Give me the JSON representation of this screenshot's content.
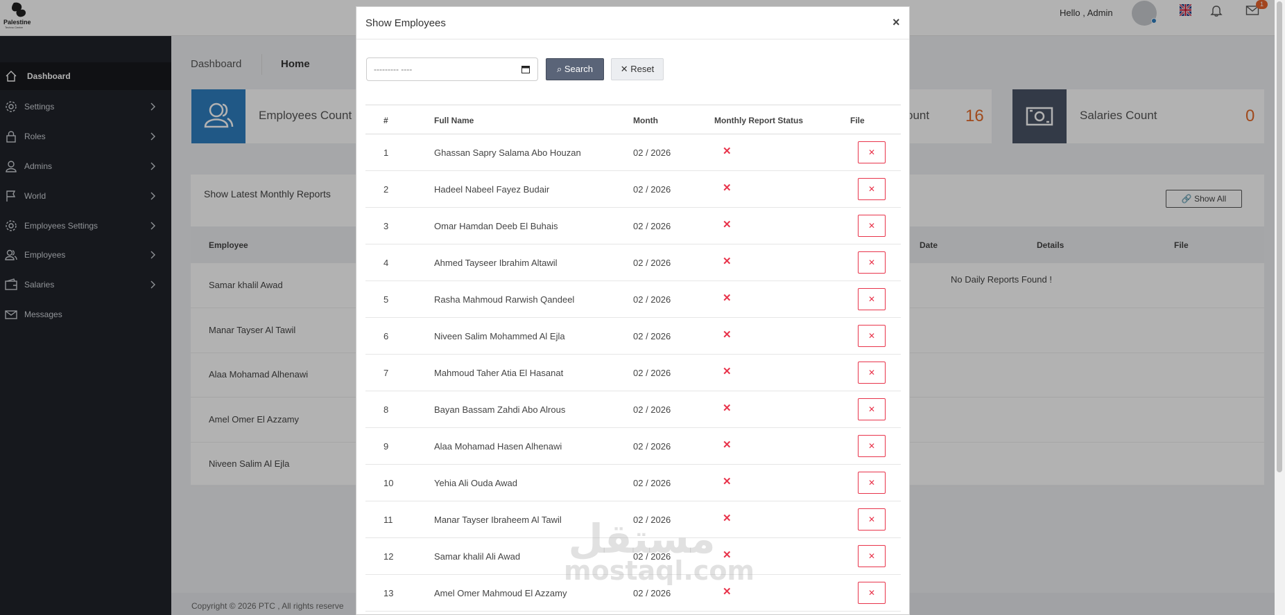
{
  "brand": {
    "name": "Palestine",
    "sub": "Techno Centre"
  },
  "header": {
    "greeting": "Hello , Admin",
    "mail_count": "1"
  },
  "sidebar": {
    "items": [
      {
        "label": "Dashboard",
        "icon": "home-icon",
        "active": true
      },
      {
        "label": "Settings",
        "icon": "gear-icon"
      },
      {
        "label": "Roles",
        "icon": "lock-icon"
      },
      {
        "label": "Admins",
        "icon": "user-icon"
      },
      {
        "label": "World",
        "icon": "flag-icon"
      },
      {
        "label": "Employees Settings",
        "icon": "gear-icon"
      },
      {
        "label": "Employees",
        "icon": "users-icon"
      },
      {
        "label": "Salaries",
        "icon": "wallet-icon"
      },
      {
        "label": "Messages",
        "icon": "mail-icon"
      }
    ]
  },
  "breadcrumb": {
    "dashboard": "Dashboard",
    "home": "Home"
  },
  "cards": {
    "employees": {
      "title": "Employees Count"
    },
    "third": {
      "title": "ount",
      "value": "16"
    },
    "salaries": {
      "title": "Salaries Count",
      "value": "0"
    }
  },
  "reports": {
    "title": "Show Latest Monthly Reports",
    "show_all": "Show All",
    "columns": {
      "employee": "Employee",
      "date": "Date",
      "details": "Details",
      "file": "File"
    },
    "rows": [
      "Samar khalil Awad",
      "Manar Tayser Al Tawil",
      "Alaa Mohamad Alhenawi",
      "Amel Omer El Azzamy",
      "Niveen Salim Al Ejla"
    ],
    "empty_daily": "No Daily Reports Found !"
  },
  "footer": {
    "copyright": "Copyright © 2026 PTC , All rights reserve"
  },
  "modal": {
    "title": "Show Employees",
    "close": "×",
    "month_placeholder": "--------- ----",
    "search_label": "Search",
    "reset_label": "Reset",
    "columns": {
      "no": "#",
      "name": "Full Name",
      "month": "Month",
      "status": "Monthly Report Status",
      "file": "File"
    },
    "rows": [
      {
        "no": "1",
        "name": "Ghassan Sapry Salama Abo Houzan",
        "month": "02 / 2026",
        "status": "✕",
        "file": "✕"
      },
      {
        "no": "2",
        "name": "Hadeel Nabeel Fayez Budair",
        "month": "02 / 2026",
        "status": "✕",
        "file": "✕"
      },
      {
        "no": "3",
        "name": "Omar Hamdan Deeb El Buhais",
        "month": "02 / 2026",
        "status": "✕",
        "file": "✕"
      },
      {
        "no": "4",
        "name": "Ahmed Tayseer Ibrahim Altawil",
        "month": "02 / 2026",
        "status": "✕",
        "file": "✕"
      },
      {
        "no": "5",
        "name": "Rasha Mahmoud Rarwish Qandeel",
        "month": "02 / 2026",
        "status": "✕",
        "file": "✕"
      },
      {
        "no": "6",
        "name": "Niveen Salim Mohammed Al Ejla",
        "month": "02 / 2026",
        "status": "✕",
        "file": "✕"
      },
      {
        "no": "7",
        "name": "Mahmoud Taher Atia El Hasanat",
        "month": "02 / 2026",
        "status": "✕",
        "file": "✕"
      },
      {
        "no": "8",
        "name": "Bayan Bassam Zahdi Abo Alrous",
        "month": "02 / 2026",
        "status": "✕",
        "file": "✕"
      },
      {
        "no": "9",
        "name": "Alaa Mohamad Hasen Alhenawi",
        "month": "02 / 2026",
        "status": "✕",
        "file": "✕"
      },
      {
        "no": "10",
        "name": "Yehia Ali Ouda Awad",
        "month": "02 / 2026",
        "status": "✕",
        "file": "✕"
      },
      {
        "no": "11",
        "name": "Manar Tayser Ibraheem Al Tawil",
        "month": "02 / 2026",
        "status": "✕",
        "file": "✕"
      },
      {
        "no": "12",
        "name": "Samar khalil Ali Awad",
        "month": "02 / 2026",
        "status": "✕",
        "file": "✕"
      },
      {
        "no": "13",
        "name": "Amel Omer Mahmoud El Azzamy",
        "month": "02 / 2026",
        "status": "✕",
        "file": "✕"
      }
    ]
  },
  "watermark": {
    "arabic": "مستقل",
    "latin": "mostaql.com"
  },
  "colors": {
    "sidebar": "#20232a",
    "accent": "#e56b2a",
    "danger": "#e8334a",
    "primary_card": "#2f7fc1",
    "dark_card": "#4a5466"
  }
}
